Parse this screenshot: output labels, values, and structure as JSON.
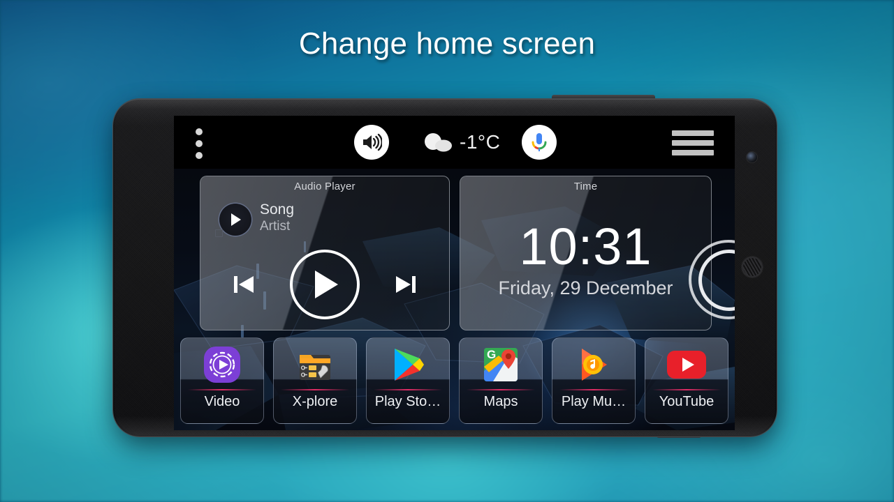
{
  "headline": "Change home screen",
  "status_bar": {
    "overflow_menu_icon": "three-dots-vertical-icon",
    "volume_button_icon": "speaker-volume-icon",
    "weather": {
      "icon": "cloud-icon",
      "temperature": "-1°C"
    },
    "assistant_button_icon": "google-microphone-icon",
    "menu_button_icon": "hamburger-menu-icon"
  },
  "widgets": {
    "audio_player": {
      "title": "Audio Player",
      "song": "Song",
      "artist": "Artist",
      "album_art_icon": "play-triangle-icon",
      "previous_icon": "skip-previous-icon",
      "play_icon": "play-icon",
      "next_icon": "skip-next-icon"
    },
    "time": {
      "title": "Time",
      "clock": "10:31",
      "date": "Friday, 29 December"
    }
  },
  "dock": {
    "apps": [
      {
        "label": "Video",
        "icon": "video-player-icon"
      },
      {
        "label": "X-plore",
        "icon": "x-plore-file-manager-icon"
      },
      {
        "label": "Play Sto…",
        "icon": "google-play-store-icon"
      },
      {
        "label": "Maps",
        "icon": "google-maps-icon"
      },
      {
        "label": "Play Mu…",
        "icon": "google-play-music-icon"
      },
      {
        "label": "YouTube",
        "icon": "youtube-icon"
      }
    ]
  },
  "device": {
    "camera_icon": "front-camera-icon",
    "earpiece_icon": "earpiece-speaker-icon"
  },
  "colors": {
    "background_teal": "#2eb2c0",
    "background_blue": "#0c4f86",
    "accent_pink": "#eb2d69",
    "video_purple": "#7c3fd6",
    "youtube_red": "#e8202a",
    "xplore_orange": "#f5a623"
  }
}
